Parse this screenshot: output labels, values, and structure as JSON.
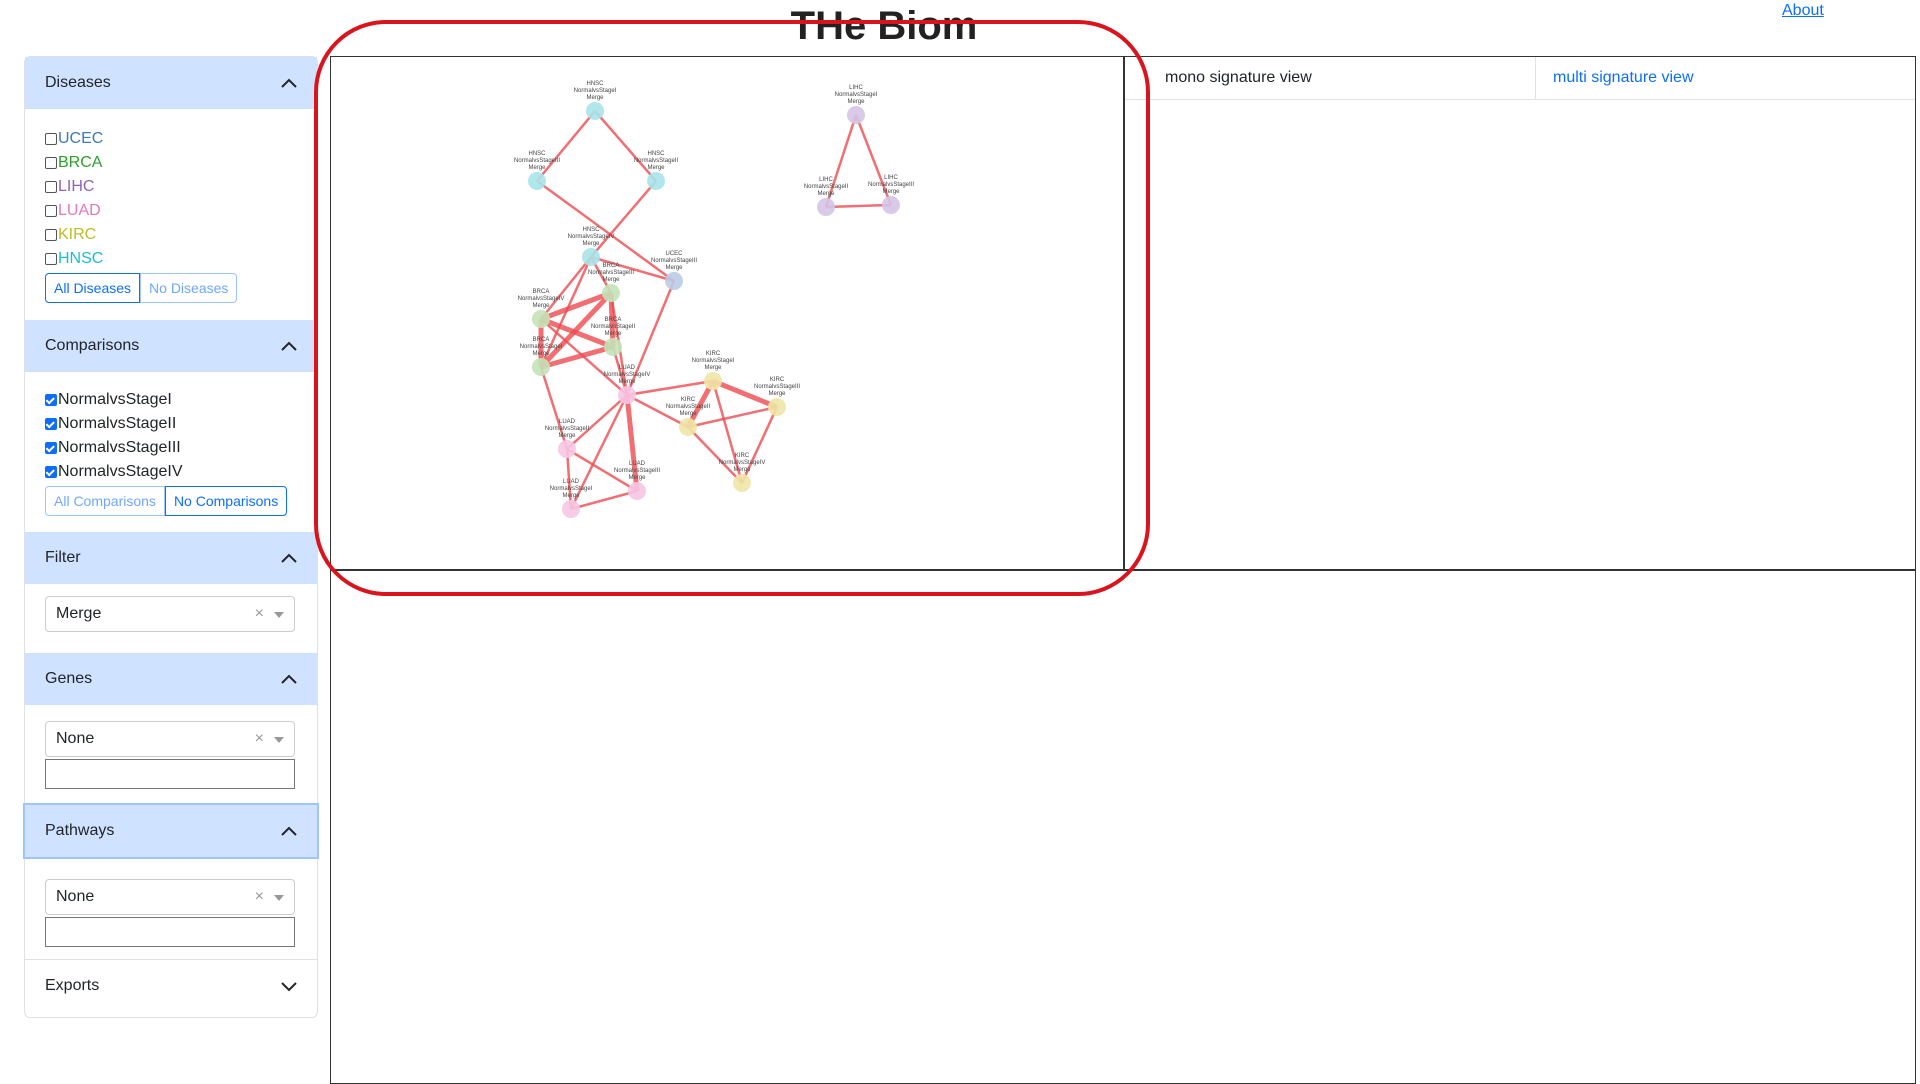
{
  "app": {
    "title": "THe Biom",
    "about": "About"
  },
  "sidebar": {
    "diseases": {
      "title": "Diseases",
      "items": [
        {
          "label": "UCEC",
          "color": "#3d7ab8",
          "checked": false
        },
        {
          "label": "BRCA",
          "color": "#2ca02c",
          "checked": false
        },
        {
          "label": "LIHC",
          "color": "#8e63b8",
          "checked": false
        },
        {
          "label": "LUAD",
          "color": "#e377c2",
          "checked": false
        },
        {
          "label": "KIRC",
          "color": "#bcbd22",
          "checked": false
        },
        {
          "label": "HNSC",
          "color": "#17becf",
          "checked": false
        }
      ],
      "all_button": "All Diseases",
      "none_button": "No Diseases"
    },
    "comparisons": {
      "title": "Comparisons",
      "items": [
        {
          "label": "NormalvsStageI",
          "checked": true
        },
        {
          "label": "NormalvsStageII",
          "checked": true
        },
        {
          "label": "NormalvsStageIII",
          "checked": true
        },
        {
          "label": "NormalvsStageIV",
          "checked": true
        }
      ],
      "all_button": "All Comparisons",
      "none_button": "No Comparisons"
    },
    "filter": {
      "title": "Filter",
      "value": "Merge"
    },
    "genes": {
      "title": "Genes",
      "value": "None",
      "input_value": ""
    },
    "pathways": {
      "title": "Pathways",
      "value": "None",
      "input_value": ""
    },
    "exports": {
      "title": "Exports"
    }
  },
  "tabs": {
    "mono": "mono signature view",
    "multi": "multi signature view"
  },
  "network": {
    "nodes": [
      {
        "id": "hnsc_i",
        "lines": [
          "HNSC",
          "NormalvsStageI",
          "Merge"
        ],
        "color": "#a8e4ea"
      },
      {
        "id": "hnsc_ii",
        "lines": [
          "HNSC",
          "NormalvsStageII",
          "Merge"
        ],
        "color": "#a8e4ea"
      },
      {
        "id": "hnsc_iii",
        "lines": [
          "HNSC",
          "NormalvsStageIII",
          "Merge"
        ],
        "color": "#a8e4ea"
      },
      {
        "id": "hnsc_iv",
        "lines": [
          "HNSC",
          "NormalvsStageIV",
          "Merge"
        ],
        "color": "#a8e4ea"
      },
      {
        "id": "lihc_i",
        "lines": [
          "LIHC",
          "NormalvsStageI",
          "Merge"
        ],
        "color": "#d5c4e8"
      },
      {
        "id": "lihc_ii",
        "lines": [
          "LIHC",
          "NormalvsStageII",
          "Merge"
        ],
        "color": "#d5c4e8"
      },
      {
        "id": "lihc_iii",
        "lines": [
          "LIHC",
          "NormalvsStageIII",
          "Merge"
        ],
        "color": "#d5c4e8"
      },
      {
        "id": "ucec_iii",
        "lines": [
          "UCEC",
          "NormalvsStageIII",
          "Merge"
        ],
        "color": "#b9cce6"
      },
      {
        "id": "brca_iii",
        "lines": [
          "BRCA",
          "NormalvsStageIII",
          "Merge"
        ],
        "color": "#c4e3b8"
      },
      {
        "id": "brca_iv",
        "lines": [
          "BRCA",
          "NormalvsStageIV",
          "Merge"
        ],
        "color": "#c4e3b8"
      },
      {
        "id": "brca_ii",
        "lines": [
          "BRCA",
          "NormalvsStageII",
          "Merge"
        ],
        "color": "#c4e3b8"
      },
      {
        "id": "brca_i",
        "lines": [
          "BRCA",
          "NormalvsStageI",
          "Merge"
        ],
        "color": "#c4e3b8"
      },
      {
        "id": "luad_iv",
        "lines": [
          "LUAD",
          "NormalvsStageIV",
          "Merge"
        ],
        "color": "#f6c6e4"
      },
      {
        "id": "luad_ii",
        "lines": [
          "LUAD",
          "NormalvsStageII",
          "Merge"
        ],
        "color": "#f6c6e4"
      },
      {
        "id": "luad_iii",
        "lines": [
          "LUAD",
          "NormalvsStageIII",
          "Merge"
        ],
        "color": "#f6c6e4"
      },
      {
        "id": "luad_i",
        "lines": [
          "LUAD",
          "NormalvsStageI",
          "Merge"
        ],
        "color": "#f6c6e4"
      },
      {
        "id": "kirc_i",
        "lines": [
          "KIRC",
          "NormalvsStageI",
          "Merge"
        ],
        "color": "#f0e6a6"
      },
      {
        "id": "kirc_iii",
        "lines": [
          "KIRC",
          "NormalvsStageIII",
          "Merge"
        ],
        "color": "#f0e6a6"
      },
      {
        "id": "kirc_iv",
        "lines": [
          "KIRC",
          "NormalvsStageIV",
          "Merge"
        ],
        "color": "#f0e6a6"
      },
      {
        "id": "kirc_ii",
        "lines": [
          "KIRC",
          "NormalvsStageII",
          "Merge"
        ],
        "color": "#f0e6a6"
      }
    ],
    "edges": [
      [
        "hnsc_i",
        "hnsc_ii"
      ],
      [
        "hnsc_i",
        "hnsc_iii"
      ],
      [
        "hnsc_ii",
        "hnsc_iv"
      ],
      [
        "hnsc_iii",
        "ucec_iii"
      ],
      [
        "lihc_i",
        "lihc_ii"
      ],
      [
        "lihc_i",
        "lihc_iii"
      ],
      [
        "lihc_ii",
        "lihc_iii"
      ],
      [
        "hnsc_iv",
        "ucec_iii"
      ],
      [
        "hnsc_iv",
        "brca_iv"
      ],
      [
        "hnsc_iv",
        "brca_iii"
      ],
      [
        "hnsc_iv",
        "brca_i"
      ],
      [
        "ucec_iii",
        "luad_iv"
      ],
      [
        "brca_iii",
        "brca_iv"
      ],
      [
        "brca_iii",
        "brca_i"
      ],
      [
        "brca_iii",
        "brca_ii"
      ],
      [
        "brca_iv",
        "brca_i"
      ],
      [
        "brca_iv",
        "brca_ii"
      ],
      [
        "brca_i",
        "brca_ii"
      ],
      [
        "brca_i",
        "luad_ii"
      ],
      [
        "brca_iv",
        "luad_iv"
      ],
      [
        "brca_ii",
        "luad_iv"
      ],
      [
        "brca_iii",
        "luad_iv"
      ],
      [
        "luad_iv",
        "luad_ii"
      ],
      [
        "luad_iv",
        "luad_iii"
      ],
      [
        "luad_iv",
        "luad_i"
      ],
      [
        "luad_ii",
        "luad_i"
      ],
      [
        "luad_i",
        "luad_iii"
      ],
      [
        "luad_ii",
        "luad_iii"
      ],
      [
        "luad_iv",
        "kirc_ii"
      ],
      [
        "luad_iv",
        "kirc_i"
      ],
      [
        "kirc_i",
        "kirc_ii"
      ],
      [
        "kirc_i",
        "kirc_iii"
      ],
      [
        "kirc_i",
        "kirc_iv"
      ],
      [
        "kirc_ii",
        "kirc_iv"
      ],
      [
        "kirc_iii",
        "kirc_iv"
      ],
      [
        "kirc_ii",
        "kirc_iii"
      ]
    ],
    "edge_color": "#ee4a4f"
  }
}
